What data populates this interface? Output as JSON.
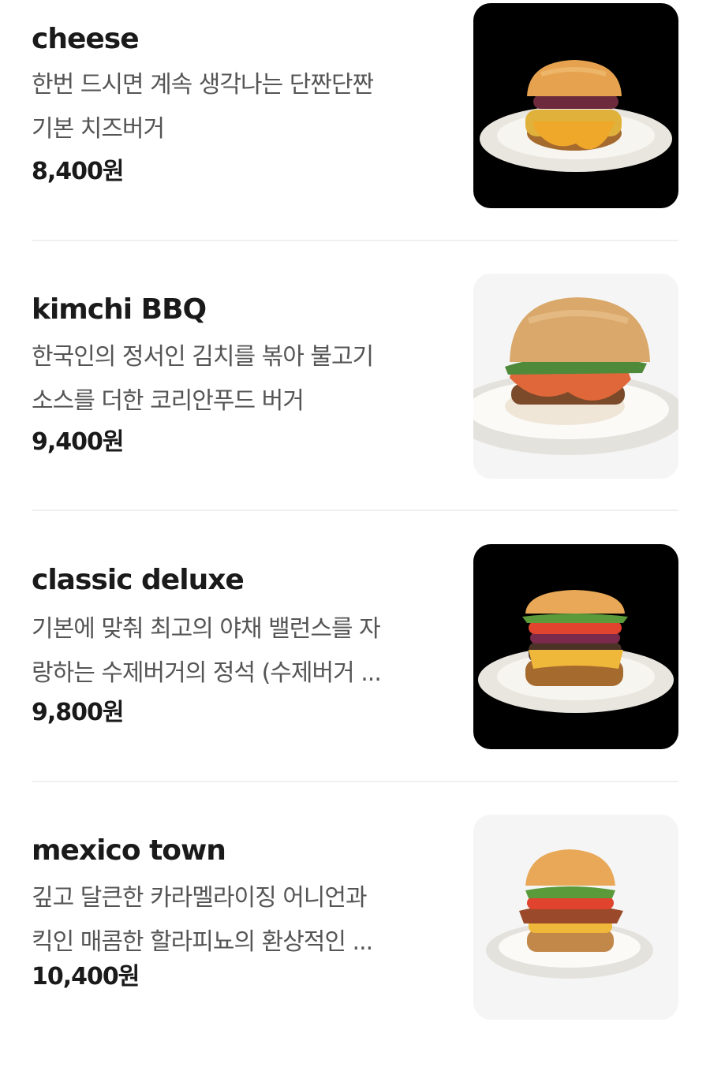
{
  "menu": {
    "items": [
      {
        "name": "cheese",
        "description_line1": "한번 드시면 계속 생각나는 단짠단짠",
        "description_line2": "기본 치즈버거",
        "price": "8,400원",
        "image": "cheese-burger-photo",
        "image_bg": "#000000"
      },
      {
        "name": "kimchi BBQ",
        "description_line1": "한국인의 정서인 김치를 볶아 불고기",
        "description_line2": "소스를 더한 코리안푸드 버거",
        "price": "9,400원",
        "image": "kimchi-bbq-burger-photo",
        "image_bg": "#f5f5f5"
      },
      {
        "name": "classic deluxe",
        "description_line1": "기본에 맞춰 최고의 야채 밸런스를 자",
        "description_line2": "랑하는 수제버거의 정석 (수제버거 ...",
        "price": "9,800원",
        "image": "classic-deluxe-burger-photo",
        "image_bg": "#000000"
      },
      {
        "name": "mexico town",
        "description_line1": "깊고 달큰한 카라멜라이징 어니언과",
        "description_line2": "킥인 매콤한 할라피뇨의 환상적인 ...",
        "price": "10,400원",
        "image": "mexico-town-burger-photo",
        "image_bg": "#f5f5f5"
      }
    ]
  }
}
